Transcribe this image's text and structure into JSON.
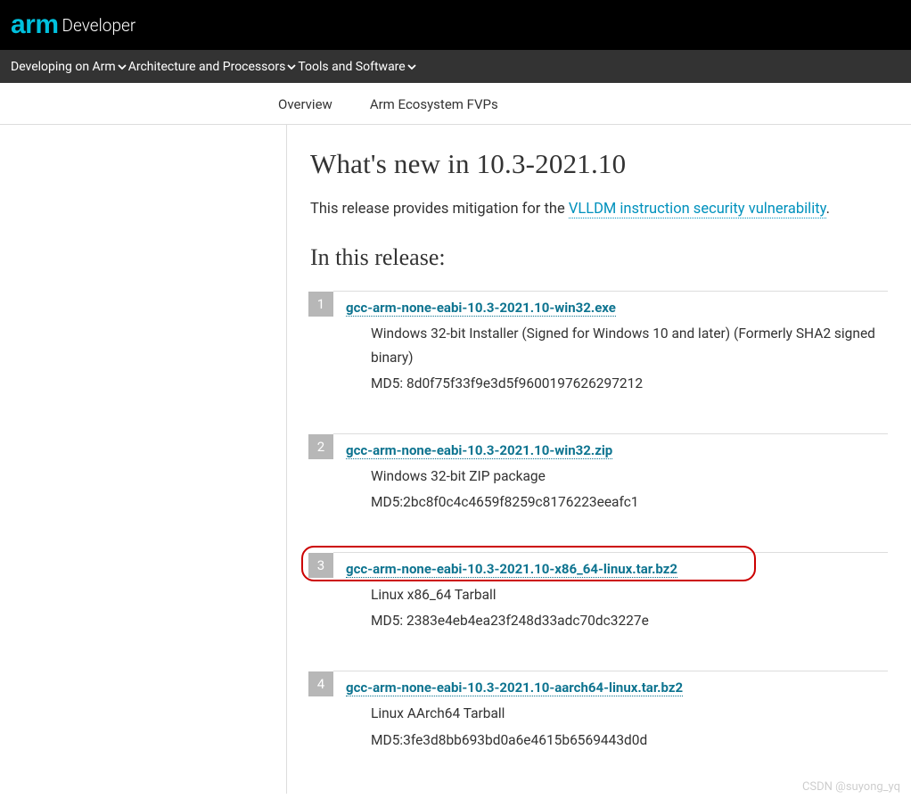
{
  "header": {
    "logo_brand": "arm",
    "logo_suffix": "Developer"
  },
  "nav": {
    "items": [
      "Developing on Arm",
      "Architecture and Processors",
      "Tools and Software"
    ]
  },
  "subnav": {
    "items": [
      "Overview",
      "Arm Ecosystem FVPs"
    ]
  },
  "content": {
    "heading": "What's new in 10.3-2021.10",
    "intro_pre": "This release provides mitigation for the ",
    "intro_link": "VLLDM instruction security vulnerability",
    "intro_post": ".",
    "subheading": "In this release:"
  },
  "downloads": [
    {
      "num": "1",
      "link": "gcc-arm-none-eabi-10.3-2021.10-win32.exe",
      "desc1": "Windows 32-bit Installer (Signed for Windows 10 and later) (Formerly SHA2 signed binary)",
      "desc2": "MD5: 8d0f75f33f9e3d5f9600197626297212",
      "highlighted": false
    },
    {
      "num": "2",
      "link": "gcc-arm-none-eabi-10.3-2021.10-win32.zip",
      "desc1": "Windows 32-bit ZIP package",
      "desc2": "MD5:2bc8f0c4c4659f8259c8176223eeafc1",
      "highlighted": false
    },
    {
      "num": "3",
      "link": "gcc-arm-none-eabi-10.3-2021.10-x86_64-linux.tar.bz2",
      "desc1": "Linux x86_64 Tarball",
      "desc2": "MD5: 2383e4eb4ea23f248d33adc70dc3227e",
      "highlighted": true
    },
    {
      "num": "4",
      "link": "gcc-arm-none-eabi-10.3-2021.10-aarch64-linux.tar.bz2",
      "desc1": "Linux AArch64 Tarball",
      "desc2": "MD5:3fe3d8bb693bd0a6e4615b6569443d0d",
      "highlighted": false
    }
  ],
  "watermark": "CSDN @suyong_yq"
}
